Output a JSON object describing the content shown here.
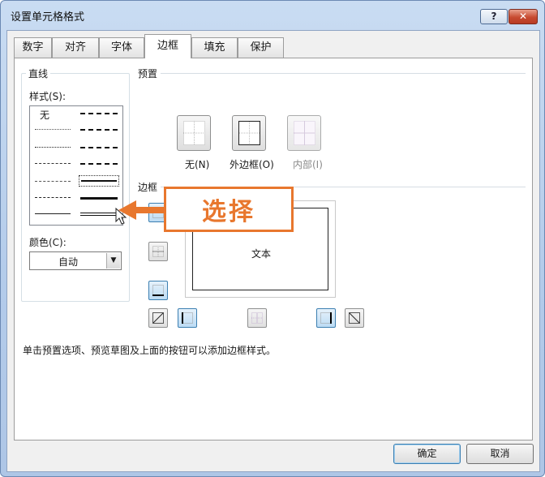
{
  "window": {
    "title": "设置单元格格式",
    "help_label": "?",
    "close_label": "✕"
  },
  "tabs": [
    {
      "label": "数字",
      "active": false
    },
    {
      "label": "对齐",
      "active": false
    },
    {
      "label": "字体",
      "active": false
    },
    {
      "label": "边框",
      "active": true
    },
    {
      "label": "填充",
      "active": false
    },
    {
      "label": "保护",
      "active": false
    }
  ],
  "line": {
    "group_label": "直线",
    "style_label": "样式(S):",
    "none_label": "无",
    "color_label": "颜色(C):",
    "color_value": "自动"
  },
  "presets": {
    "section_label": "预置",
    "items": [
      {
        "label": "无(N)",
        "icon": "preset-none-icon",
        "enabled": true
      },
      {
        "label": "外边框(O)",
        "icon": "preset-outline-icon",
        "enabled": true
      },
      {
        "label": "内部(I)",
        "icon": "preset-inside-icon",
        "enabled": false
      }
    ]
  },
  "border": {
    "section_label": "边框",
    "preview_text": "文本"
  },
  "hint": "单击预置选项、预览草图及上面的按钮可以添加边框样式。",
  "annotation": {
    "text": "选择",
    "color": "#e8772e"
  },
  "buttons": {
    "ok": "确定",
    "cancel": "取消"
  },
  "colors": {
    "accent": "#3c7fb1",
    "callout": "#e8772e"
  }
}
